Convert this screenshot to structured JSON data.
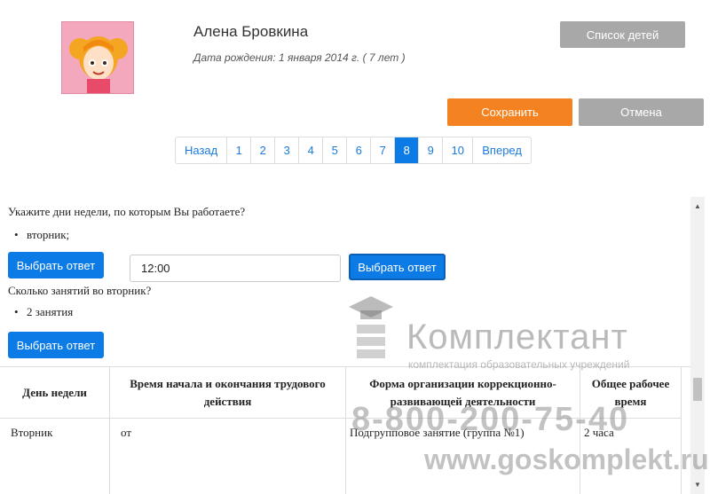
{
  "header": {
    "child_name": "Алена Бровкина",
    "birth_info": "Дата рождения: 1 января 2014 г. ( 7 лет )",
    "children_list_label": "Список детей",
    "save_label": "Сохранить",
    "cancel_label": "Отмена"
  },
  "pagination": {
    "prev": "Назад",
    "pages": [
      "1",
      "2",
      "3",
      "4",
      "5",
      "6",
      "7",
      "8",
      "9",
      "10"
    ],
    "active": "8",
    "next": "Вперед"
  },
  "form": {
    "q1": "Укажите дни недели, по которым Вы работаете?",
    "a1": "вторник;",
    "choose_label": "Выбрать ответ",
    "q2": "Сколько занятий во вторник?",
    "a2": "2 занятия",
    "table": {
      "headers": [
        "День недели",
        "Время начала и окончания трудового действия",
        "Форма организации коррекционно-развивающей деятельности",
        "Общее рабочее время"
      ],
      "row": {
        "day": "Вторник",
        "from_label": "от",
        "from_value": "12:00",
        "form": "Подгрупповое занятие (группа №1)",
        "total": "2 часа"
      }
    }
  },
  "watermark": {
    "brand": "Комплектант",
    "tagline": "комплектация образовательных учреждений",
    "phone": "8-800-200-75-40",
    "site": "www.goskomplekt.ru"
  }
}
